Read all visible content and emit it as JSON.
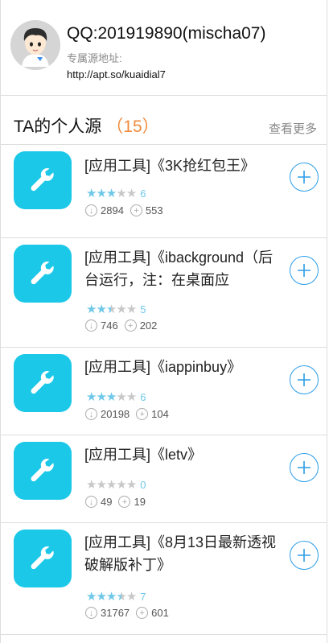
{
  "profile": {
    "title": "QQ:201919890(mischa07)",
    "subtitle": "专属源地址:",
    "url": "http://apt.so/kuaidial7"
  },
  "section": {
    "title": "TA的个人源",
    "count": "（15）",
    "more": "查看更多"
  },
  "colors": {
    "accent": "#2a9ee8",
    "star": "#6fc8e8",
    "icon_bg": "#1bc8e8",
    "count": "#f08a3c"
  },
  "apps": [
    {
      "name": "[应用工具]《3K抢红包王》",
      "rating": 3,
      "rating_text": "6",
      "downloads": "2894",
      "adds": "553"
    },
    {
      "name": "[应用工具]《ibackground（后台运行，注：在桌面应",
      "rating": 2.5,
      "rating_text": "5",
      "downloads": "746",
      "adds": "202"
    },
    {
      "name": "[应用工具]《iappinbuy》",
      "rating": 3,
      "rating_text": "6",
      "downloads": "20198",
      "adds": "104"
    },
    {
      "name": "[应用工具]《letv》",
      "rating": 0,
      "rating_text": "0",
      "downloads": "49",
      "adds": "19"
    },
    {
      "name": "[应用工具]《8月13日最新透视破解版补丁》",
      "rating": 3.5,
      "rating_text": "7",
      "downloads": "31767",
      "adds": "601"
    }
  ]
}
